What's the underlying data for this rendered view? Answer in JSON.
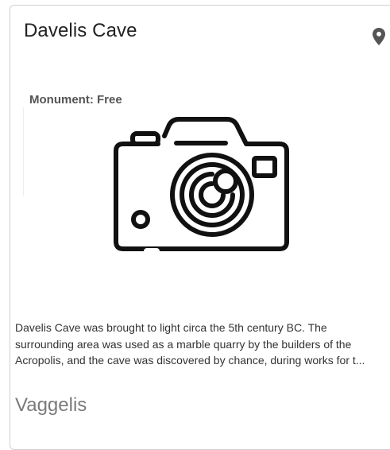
{
  "card": {
    "title": "Davelis Cave",
    "location_icon": "map-pin-icon",
    "image": {
      "label": "Monument: Free",
      "icon": "camera-icon"
    },
    "description": "Davelis Cave was brought to light circa the 5th century BC. The surrounding area was used as a marble quarry by the builders of the Acropolis, and the cave was discovered by chance, during works for t...",
    "author": "Vaggelis"
  },
  "colors": {
    "border": "#cfcfcf",
    "title": "#222222",
    "icon": "#555555",
    "author": "#7a7a7a"
  }
}
